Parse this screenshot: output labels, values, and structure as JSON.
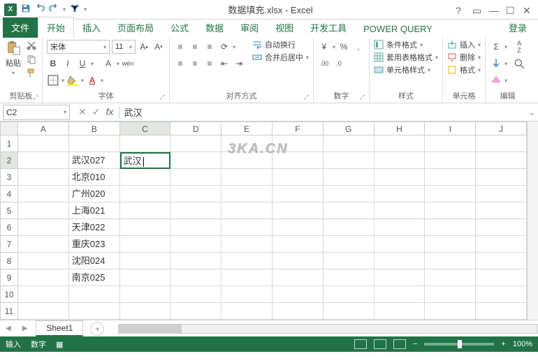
{
  "title": "数据填充.xlsx - Excel",
  "tabs": {
    "file": "文件",
    "home": "开始",
    "insert": "插入",
    "layout": "页面布局",
    "formulas": "公式",
    "data": "数据",
    "review": "审阅",
    "view": "视图",
    "dev": "开发工具",
    "pq": "POWER QUERY",
    "login": "登录"
  },
  "ribbon": {
    "clipboard": {
      "paste": "粘贴",
      "label": "剪贴板"
    },
    "font": {
      "name": "宋体",
      "size": "11",
      "label": "字体"
    },
    "align": {
      "wrap": "自动换行",
      "merge": "合并后居中",
      "label": "对齐方式"
    },
    "number": {
      "label": "数字"
    },
    "styles": {
      "cond": "条件格式",
      "table": "套用表格格式",
      "cell": "单元格样式",
      "label": "样式"
    },
    "cells": {
      "insert": "插入",
      "delete": "删除",
      "format": "格式",
      "label": "单元格"
    },
    "editing": {
      "label": "编辑"
    }
  },
  "namebox": "C2",
  "formula": "武汉",
  "columns": [
    "A",
    "B",
    "C",
    "D",
    "E",
    "F",
    "G",
    "H",
    "I",
    "J"
  ],
  "rows": [
    "1",
    "2",
    "3",
    "4",
    "5",
    "6",
    "7",
    "8",
    "9",
    "10",
    "11"
  ],
  "activeRow": 2,
  "activeCol": "C",
  "cells": {
    "B2": "武汉027",
    "C2": "武汉",
    "B3": "北京010",
    "B4": "广州020",
    "B5": "上海021",
    "B6": "天津022",
    "B7": "重庆023",
    "B8": "沈阳024",
    "B9": "南京025"
  },
  "watermark": "3KA.CN",
  "sheet": "Sheet1",
  "status": {
    "mode": "输入",
    "numlock": "数字",
    "zoom": "100%"
  }
}
